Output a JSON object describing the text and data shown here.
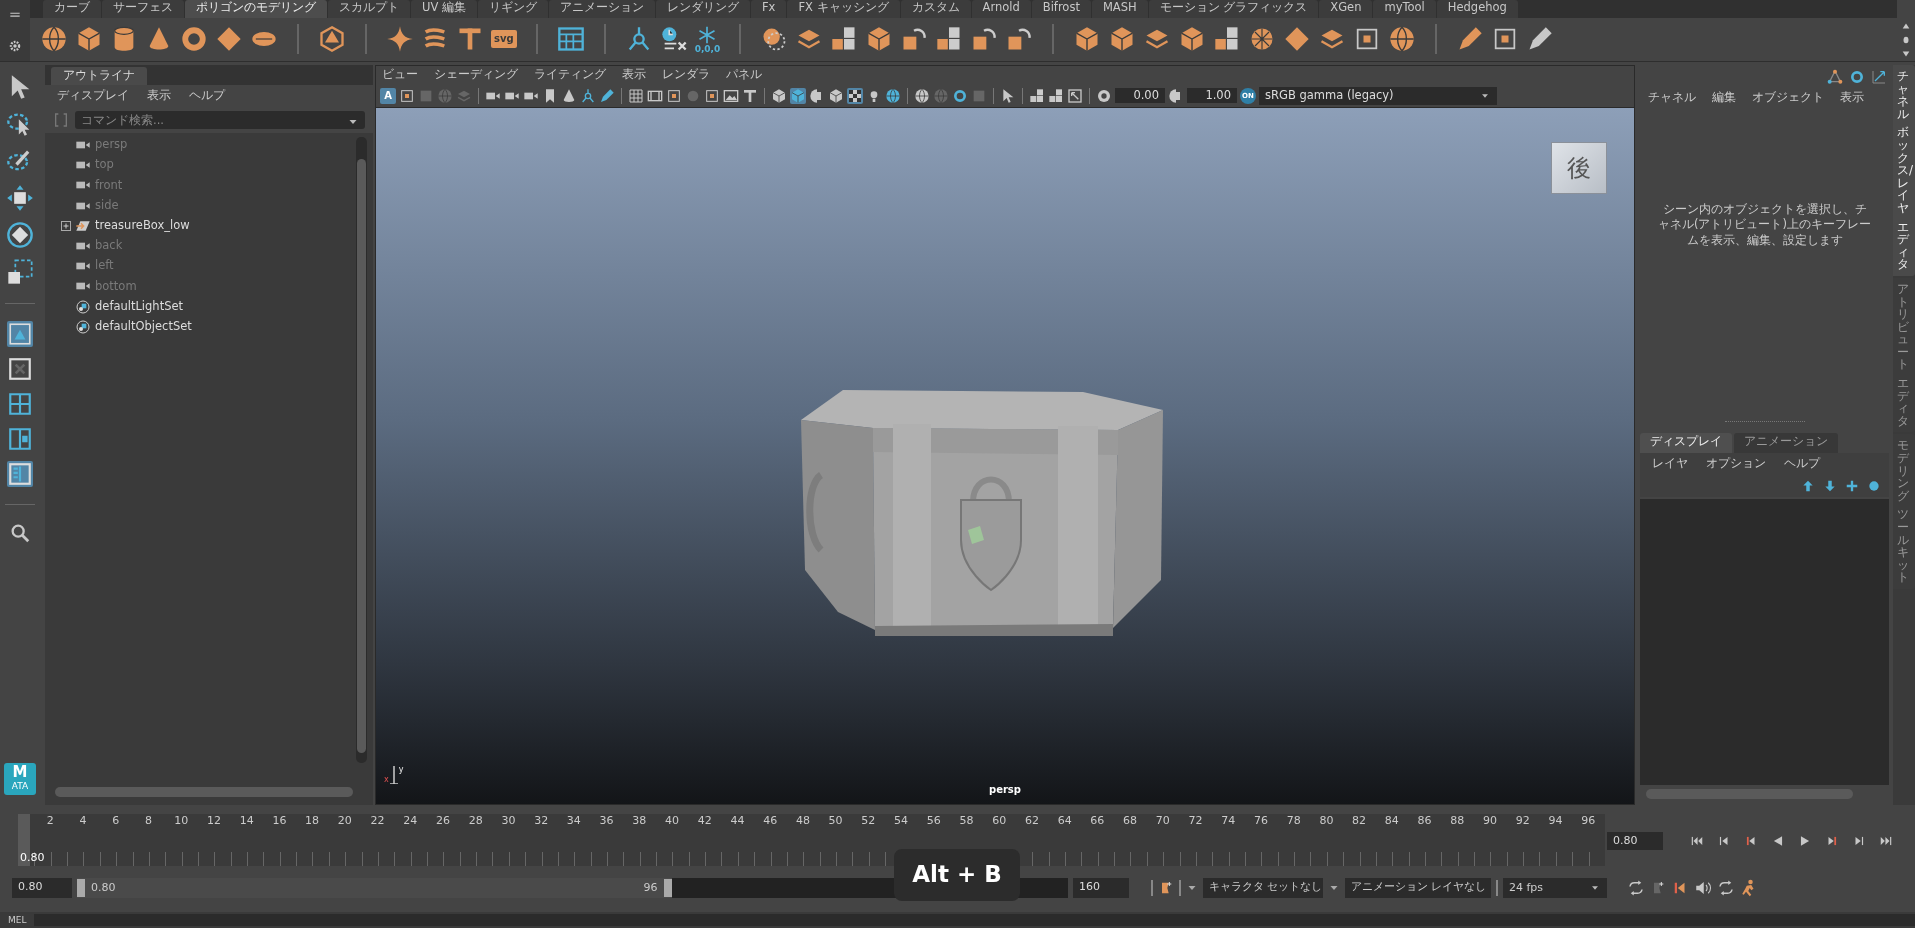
{
  "shelf": {
    "tabs": [
      {
        "label": "カーブ",
        "selected": false
      },
      {
        "label": "サーフェス",
        "selected": false
      },
      {
        "label": "ポリゴンのモデリング",
        "selected": true
      },
      {
        "label": "スカルプト",
        "selected": false
      },
      {
        "label": "UV 編集",
        "selected": false
      },
      {
        "label": "リギング",
        "selected": false
      },
      {
        "label": "アニメーション",
        "selected": false
      },
      {
        "label": "レンダリング",
        "selected": false
      },
      {
        "label": "Fx",
        "selected": false
      },
      {
        "label": "FX キャッシング",
        "selected": false
      },
      {
        "label": "カスタム",
        "selected": false
      },
      {
        "label": "Arnold",
        "selected": false
      },
      {
        "label": "Bifrost",
        "selected": false
      },
      {
        "label": "MASH",
        "selected": false
      },
      {
        "label": "モーション グラフィックス",
        "selected": false
      },
      {
        "label": "XGen",
        "selected": false
      },
      {
        "label": "myTool",
        "selected": false
      },
      {
        "label": "Hedgehog",
        "selected": false
      }
    ],
    "svg_label": "svg",
    "snap_label": "0,0,0"
  },
  "toolbox": {
    "tools": [
      {
        "on": false
      },
      {
        "on": false
      },
      {
        "on": false
      },
      {
        "on": false
      },
      {
        "on": false
      },
      {
        "on": false
      }
    ],
    "layouts": [
      {
        "on": true
      },
      {
        "on": false
      },
      {
        "on": false
      },
      {
        "on": false
      },
      {
        "on": true
      }
    ],
    "logo": "M",
    "logo_sub": "ATA"
  },
  "outliner": {
    "tab": "アウトライナ",
    "menus": [
      "ディスプレイ",
      "表示",
      "ヘルプ"
    ],
    "search": {
      "placeholder": "コマンド検索..."
    },
    "items": [
      {
        "label": "persp",
        "kind": "camera",
        "dimmed": true
      },
      {
        "label": "top",
        "kind": "camera",
        "dimmed": true
      },
      {
        "label": "front",
        "kind": "camera",
        "dimmed": true
      },
      {
        "label": "side",
        "kind": "camera",
        "dimmed": true
      },
      {
        "label": "treasureBox_low",
        "kind": "mesh",
        "dimmed": false,
        "expanded": false
      },
      {
        "label": "back",
        "kind": "camera",
        "dimmed": true
      },
      {
        "label": "left",
        "kind": "camera",
        "dimmed": true
      },
      {
        "label": "bottom",
        "kind": "camera",
        "dimmed": true
      },
      {
        "label": "defaultLightSet",
        "kind": "set",
        "dimmed": false
      },
      {
        "label": "defaultObjectSet",
        "kind": "set",
        "dimmed": false
      }
    ]
  },
  "viewport": {
    "menus": [
      "ビュー",
      "シェーディング",
      "ライティング",
      "表示",
      "レンダラ",
      "パネル"
    ],
    "letter_button": "A",
    "toggles": [
      {
        "on": true
      },
      {
        "on": false
      },
      {
        "on": false
      },
      {
        "on": false
      },
      {
        "on": false
      },
      {
        "on": false
      },
      {
        "on": false
      },
      {
        "on": false
      },
      {
        "on": false
      },
      {
        "on": false
      },
      {
        "on": false
      },
      {
        "on": false
      },
      {
        "on": false
      },
      {
        "on": false
      },
      {
        "on": false
      },
      {
        "on": false
      },
      {
        "on": false
      },
      {
        "on": false
      },
      {
        "on": false
      },
      {
        "on": false
      },
      {
        "on": true
      },
      {
        "on": false
      },
      {
        "on": false
      },
      {
        "on": true
      },
      {
        "on": false
      },
      {
        "on": false
      },
      {
        "on": false
      },
      {
        "on": false
      },
      {
        "on": false
      },
      {
        "on": false
      },
      {
        "on": false
      },
      {
        "on": false
      },
      {
        "on": false
      },
      {
        "on": false
      },
      {
        "on": false
      },
      {
        "on": false
      }
    ],
    "exposure": "0.00",
    "gamma": "1.00",
    "color_badge": "ON",
    "color_space": "sRGB gamma (legacy)",
    "view_cube": "後",
    "camera": "persp",
    "axes": [
      "x",
      "y"
    ]
  },
  "channel_box": {
    "menus": [
      "チャネル",
      "編集",
      "オブジェクト",
      "表示"
    ],
    "message": "シーン内のオブジェクトを選択し、チャネル(アトリビュート)上のキーフレームを表示、編集、設定します",
    "layer_tabs": [
      {
        "label": "ディスプレイ",
        "selected": true
      },
      {
        "label": "アニメーション",
        "selected": false
      }
    ],
    "layer_menus": [
      "レイヤ",
      "オプション",
      "ヘルプ"
    ]
  },
  "side_tabs": [
    {
      "words": [
        "チャネル",
        "ボックス/レイヤ",
        "エディタ"
      ],
      "selected": true
    },
    {
      "words": [
        "アトリビュート",
        "エディタ"
      ],
      "selected": false
    },
    {
      "words": [
        "モデリング",
        "ツールキット"
      ],
      "selected": false
    }
  ],
  "timeline": {
    "ticks": [
      "2",
      "4",
      "6",
      "8",
      "10",
      "12",
      "14",
      "16",
      "18",
      "20",
      "22",
      "24",
      "26",
      "28",
      "30",
      "32",
      "34",
      "36",
      "38",
      "40",
      "42",
      "44",
      "46",
      "48",
      "50",
      "52",
      "54",
      "56",
      "58",
      "60",
      "62",
      "64",
      "66",
      "68",
      "70",
      "72",
      "74",
      "76",
      "78",
      "80",
      "82",
      "84",
      "86",
      "88",
      "90",
      "92",
      "94",
      "96"
    ],
    "current": "0.80",
    "level": 0.0,
    "current_field": "0.80"
  },
  "range": {
    "start": "0.80",
    "inner_start": "0.80",
    "inner_end": "96",
    "end": "160",
    "level": 0.6,
    "character_set": "キャラクタ セットなし",
    "anim_layer": "アニメーション レイヤなし",
    "fps": "24 fps"
  },
  "shortcut": "Alt + B",
  "command_line": {
    "language": "MEL"
  }
}
